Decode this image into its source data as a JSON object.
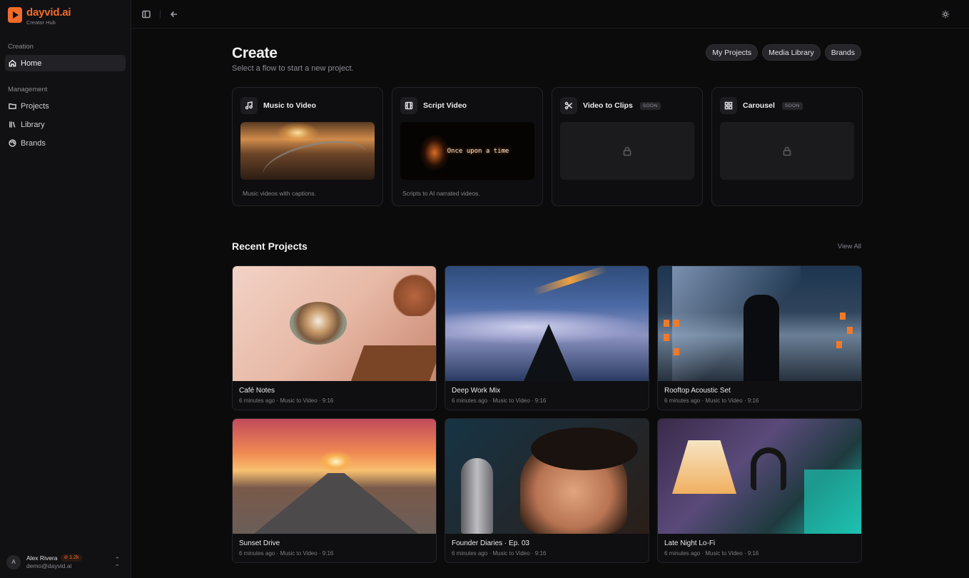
{
  "brand": {
    "name": "dayvid.ai",
    "subtitle": "Creator Hub",
    "accent": "#f26b2a"
  },
  "sidebar": {
    "sections": [
      {
        "label": "Creation",
        "items": [
          {
            "label": "Home",
            "icon": "home-icon",
            "active": true
          }
        ]
      },
      {
        "label": "Management",
        "items": [
          {
            "label": "Projects",
            "icon": "folder-icon"
          },
          {
            "label": "Library",
            "icon": "library-icon"
          },
          {
            "label": "Brands",
            "icon": "palette-icon"
          }
        ]
      }
    ]
  },
  "user": {
    "initial": "A",
    "name": "Alex Rivera",
    "credits": "1.2k",
    "email": "demo@dayvid.ai"
  },
  "header": {
    "title": "Create",
    "subtitle": "Select a flow to start a new project.",
    "pills": [
      "My Projects",
      "Media Library",
      "Brands"
    ]
  },
  "flows": [
    {
      "title": "Music to Video",
      "icon": "music-note-icon",
      "description": "Music videos with captions.",
      "soon": false
    },
    {
      "title": "Script Video",
      "icon": "film-icon",
      "description": "Scripts to AI narrated videos.",
      "thumb_text": "Once upon a time",
      "soon": false
    },
    {
      "title": "Video to Clips",
      "icon": "scissors-icon",
      "badge": "SOON",
      "soon": true
    },
    {
      "title": "Carousel",
      "icon": "grid-icon",
      "badge": "SOON",
      "soon": true
    }
  ],
  "recent": {
    "title": "Recent Projects",
    "view_all": "View All",
    "projects": [
      {
        "title": "Café Notes",
        "meta": "6 minutes ago · Music to Video · 9:16"
      },
      {
        "title": "Deep Work Mix",
        "meta": "6 minutes ago · Music to Video · 9:16"
      },
      {
        "title": "Rooftop Acoustic Set",
        "meta": "6 minutes ago · Music to Video · 9:16"
      },
      {
        "title": "Sunset Drive",
        "meta": "6 minutes ago · Music to Video · 9:16"
      },
      {
        "title": "Founder Diaries · Ep. 03",
        "meta": "6 minutes ago · Music to Video · 9:16"
      },
      {
        "title": "Late Night Lo-Fi",
        "meta": "6 minutes ago · Music to Video · 9:16"
      }
    ]
  }
}
